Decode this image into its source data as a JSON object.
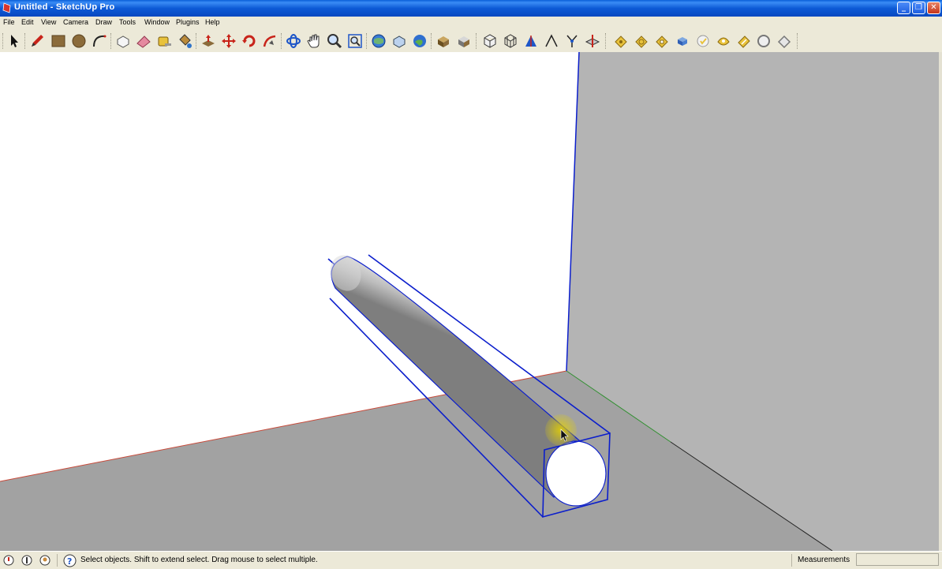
{
  "window": {
    "title": "Untitled - SketchUp Pro",
    "app_icon": "sketchup-icon",
    "controls": [
      "minimize-icon",
      "maximize-icon",
      "close-icon"
    ]
  },
  "menu": [
    "File",
    "Edit",
    "View",
    "Camera",
    "Draw",
    "Tools",
    "Window",
    "Plugins",
    "Help"
  ],
  "toolbar": {
    "tools": [
      "select-icon",
      "pencil-icon",
      "rectangle-icon",
      "circle-icon",
      "arc-icon",
      "make-component-icon",
      "eraser-icon",
      "tape-measure-icon",
      "paint-bucket-icon",
      "push-pull-icon",
      "move-icon",
      "rotate-icon",
      "follow-me-icon",
      "orbit-icon",
      "pan-icon",
      "zoom-icon",
      "zoom-extents-icon",
      "get-models-icon",
      "share-model-icon",
      "google-earth-icon",
      "get-photo-texture-icon",
      "component-3d-icon",
      "iso-view-icon",
      "wireframe-icon",
      "axes-icon",
      "dimension-icon",
      "protractor-icon",
      "section-plane-icon",
      "sandbox-from-contours-icon",
      "sandbox-from-scratch-icon",
      "smoove-icon",
      "stamp-icon",
      "drape-icon",
      "add-detail-icon",
      "flip-edge-icon",
      "circle-outline-icon",
      "tag-icon"
    ],
    "colors": {
      "red": "#c8241a",
      "blue": "#1e56c8",
      "brown": "#8b6b3a",
      "yellow": "#e8c23c"
    }
  },
  "viewport": {
    "colors": {
      "wall_left": "#ffffff",
      "wall_right": "#b4b4b4",
      "floor": "#a2a2a2",
      "selection_blue": "#0b1ecc",
      "red_axis": "#c84a3a",
      "green_axis": "#2f8f2f",
      "cursor_highlight": "#e6d200"
    },
    "object": "selected-cylinder",
    "cursor": "select-arrow-cursor"
  },
  "status": {
    "icons": [
      "geo-location-icon",
      "credits-icon",
      "user-icon",
      "help-icon"
    ],
    "message": "Select objects. Shift to extend select. Drag mouse to select multiple.",
    "measurements_label": "Measurements",
    "measurements_value": ""
  }
}
